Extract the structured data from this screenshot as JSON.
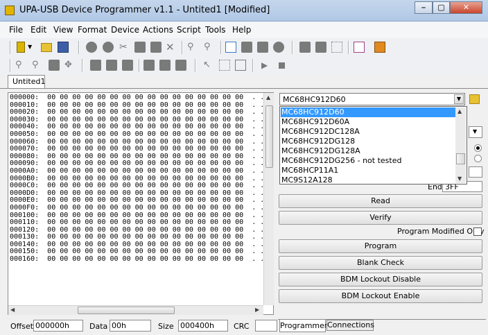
{
  "window": {
    "title": "UPA-USB Device Programmer v1.1  - Untited1 [Modified]",
    "min": "⎯",
    "max": "▢",
    "close": "✕"
  },
  "menu": [
    "File",
    "Edit",
    "View",
    "Format",
    "Device",
    "Actions",
    "Script",
    "Tools",
    "Help"
  ],
  "file_tab": "Untited1",
  "hex_rows": [
    "000000:  00 00 00 00 00 00 00 00 00 00 00 00 00 00 00 00  . .",
    "000010:  00 00 00 00 00 00 00 00 00 00 00 00 00 00 00 00  . .",
    "000020:  00 00 00 00 00 00 00 00 00 00 00 00 00 00 00 00  . .",
    "000030:  00 00 00 00 00 00 00 00 00 00 00 00 00 00 00 00  . .",
    "000040:  00 00 00 00 00 00 00 00 00 00 00 00 00 00 00 00  . .",
    "000050:  00 00 00 00 00 00 00 00 00 00 00 00 00 00 00 00  . .",
    "000060:  00 00 00 00 00 00 00 00 00 00 00 00 00 00 00 00  . .",
    "000070:  00 00 00 00 00 00 00 00 00 00 00 00 00 00 00 00  . .",
    "000080:  00 00 00 00 00 00 00 00 00 00 00 00 00 00 00 00  . .",
    "000090:  00 00 00 00 00 00 00 00 00 00 00 00 00 00 00 00  . .",
    "0000A0:  00 00 00 00 00 00 00 00 00 00 00 00 00 00 00 00  . .",
    "0000B0:  00 00 00 00 00 00 00 00 00 00 00 00 00 00 00 00  . .",
    "0000C0:  00 00 00 00 00 00 00 00 00 00 00 00 00 00 00 00  . .",
    "0000D0:  00 00 00 00 00 00 00 00 00 00 00 00 00 00 00 00  . .",
    "0000E0:  00 00 00 00 00 00 00 00 00 00 00 00 00 00 00 00  . .",
    "0000F0:  00 00 00 00 00 00 00 00 00 00 00 00 00 00 00 00  . .",
    "000100:  00 00 00 00 00 00 00 00 00 00 00 00 00 00 00 00  . .",
    "000110:  00 00 00 00 00 00 00 00 00 00 00 00 00 00 00 00  . .",
    "000120:  00 00 00 00 00 00 00 00 00 00 00 00 00 00 00 00  . .",
    "000130:  00 00 00 00 00 00 00 00 00 00 00 00 00 00 00 00  . .",
    "000140:  00 00 00 00 00 00 00 00 00 00 00 00 00 00 00 00  . .",
    "000150:  00 00 00 00 00 00 00 00 00 00 00 00 00 00 00 00  . .",
    "000160:  00 00 00 00 00 00 00 00 00 00 00 00 00 00 00 00  . ."
  ],
  "status": {
    "offset_label": "Offset",
    "offset_value": "000000h",
    "data_label": "Data",
    "data_value": "00h",
    "size_label": "Size",
    "size_value": "000400h",
    "crc_label": "CRC",
    "crc_value": ""
  },
  "device": {
    "selected": "MC68HC912D60",
    "options": [
      "MC68HC912D60",
      "MC68HC912D60A",
      "MC68HC912DC128A",
      "MC68HC912DG128",
      "MC68HC912DG128A",
      "MC68HC912DG256 - not tested",
      "MC68HCP11A1",
      "MC9S12A128"
    ]
  },
  "end_label": "End",
  "end_value": "3FF",
  "buttons": {
    "read": "Read",
    "verify": "Verify",
    "program_modified_only": "Program Modified Only",
    "program": "Program",
    "blank_check": "Blank Check",
    "bdm_lockout_disable": "BDM Lockout Disable",
    "bdm_lockout_enable": "BDM Lockout Enable"
  },
  "tabs": {
    "programmer": "Programmer",
    "connections": "Connections"
  },
  "colors": {
    "selection": "#3399ff",
    "title_bar": "#b9cfea"
  }
}
